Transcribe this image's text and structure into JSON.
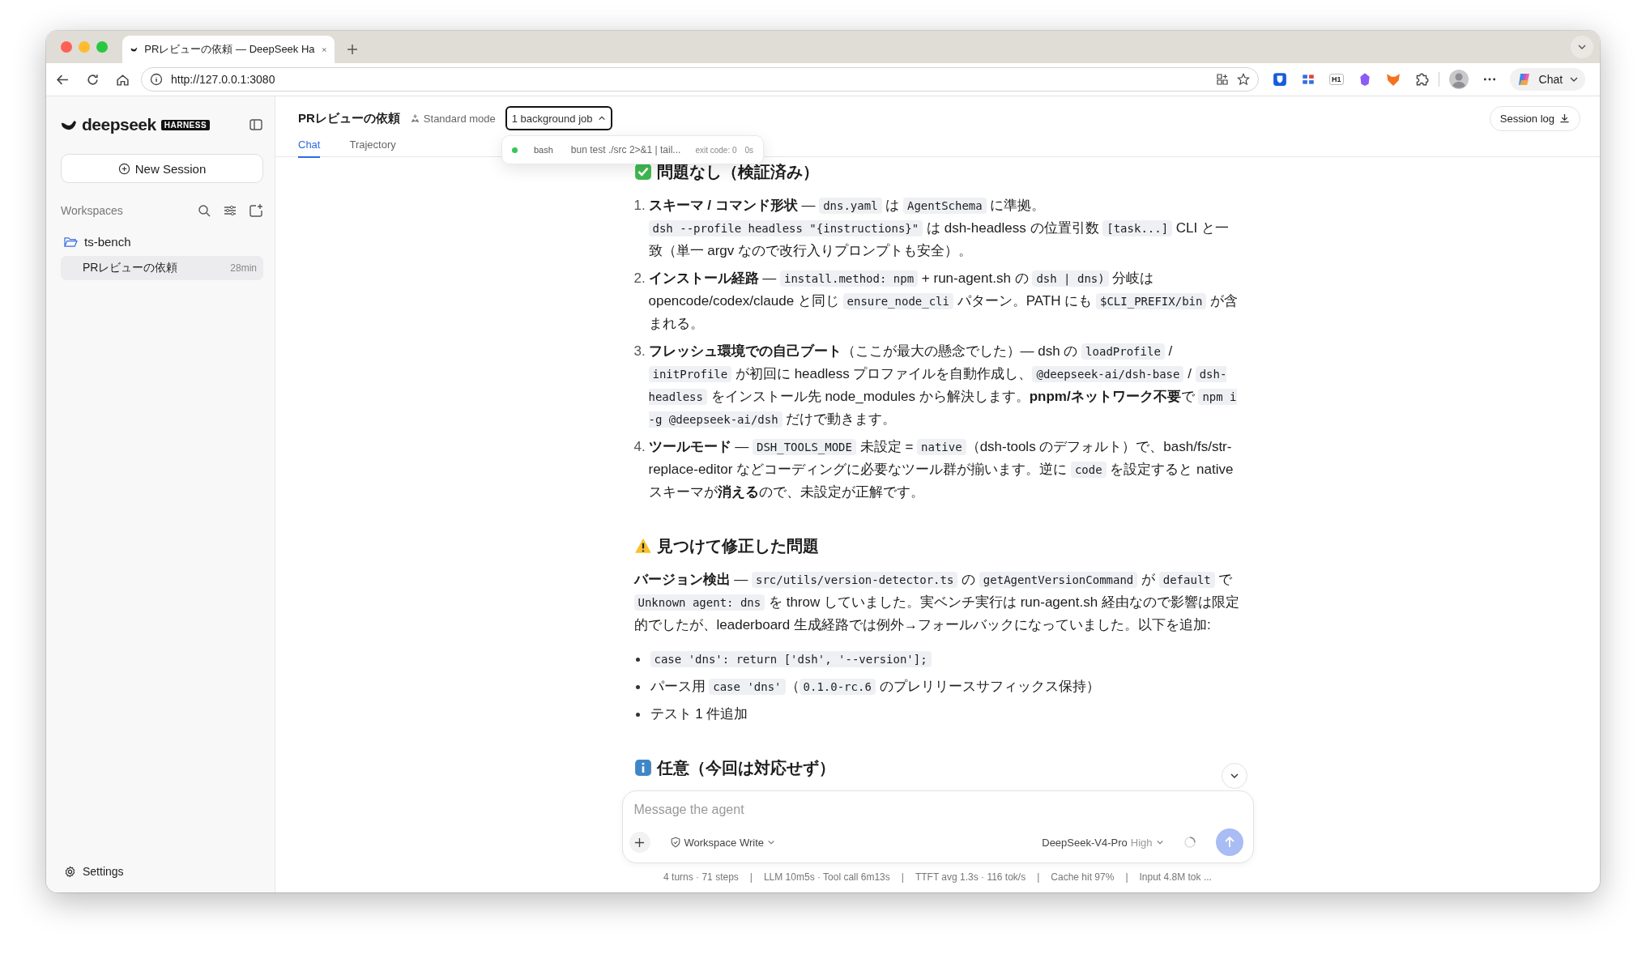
{
  "browser": {
    "tab_title": "PRレビューの依頼 — DeepSeek Ha",
    "url": "http://127.0.0.1:3080",
    "extensions": [
      {
        "kind": "shield"
      },
      {
        "kind": "grid"
      },
      {
        "kind": "badge",
        "label": "H1"
      },
      {
        "kind": "gem"
      },
      {
        "kind": "fox"
      },
      {
        "kind": "puzzle"
      }
    ],
    "copilot_label": "Chat"
  },
  "sidebar": {
    "logo": "deepseek",
    "badge": "HARNESS",
    "new_session": "New Session",
    "workspaces_label": "Workspaces",
    "tree": [
      {
        "name": "ts-bench",
        "expanded": true,
        "children": [
          {
            "title": "PRレビューの依頼",
            "time": "28min",
            "selected": true
          }
        ]
      }
    ],
    "settings": "Settings"
  },
  "header": {
    "title": "PRレビューの依頼",
    "mode": "Standard mode",
    "jobs_button": "1 background job",
    "jobs_expanded": true,
    "tabs": [
      {
        "label": "Chat",
        "selected": true
      },
      {
        "label": "Trajectory",
        "selected": false
      }
    ],
    "session_log": "Session log",
    "jobs": [
      {
        "color": "#34c759",
        "tool": "bash",
        "command": "bun test ./src 2>&1 | tail...",
        "exit": "exit code: 0",
        "duration": "0s"
      }
    ]
  },
  "content": [
    {
      "kind": "heading",
      "text": "問題なし（検証済み）"
    },
    {
      "kind": "ordered",
      "items": [
        {
          "number": "1.",
          "segments": [
            {
              "kind": "text",
              "text": "**スキーマ / コマンド形状** — "
            },
            {
              "kind": "code",
              "text": "dns.yaml"
            },
            {
              "kind": "text",
              "text": " は "
            },
            {
              "kind": "code",
              "text": "AgentSchema"
            },
            {
              "kind": "text",
              "text": " に準拠。"
            },
            {
              "kind": "break"
            },
            {
              "kind": "code",
              "text": "dsh --profile headless \"{instructions}\""
            },
            {
              "kind": "text",
              "text": " は dsh-headless の位置引数 "
            },
            {
              "kind": "code",
              "text": "[task...]"
            },
            {
              "kind": "text",
              "text": " CLI と一致（単一 argv なので改行入りプロンプトも安全）。"
            }
          ]
        },
        {
          "number": "2.",
          "segments": [
            {
              "kind": "text",
              "text": "**インストール経路** — "
            },
            {
              "kind": "code",
              "text": "install.method: npm"
            },
            {
              "kind": "text",
              "text": " + run-agent.sh の "
            },
            {
              "kind": "code",
              "text": "dsh | dns)"
            },
            {
              "kind": "text",
              "text": " 分岐は opencode/codex/claude と同じ "
            },
            {
              "kind": "code",
              "text": "ensure_node_cli"
            },
            {
              "kind": "text",
              "text": " パターン。PATH にも "
            },
            {
              "kind": "code",
              "text": "$CLI_PREFIX/bin"
            },
            {
              "kind": "text",
              "text": " が含まれる。"
            }
          ]
        },
        {
          "number": "3.",
          "segments": [
            {
              "kind": "text",
              "text": "**フレッシュ環境での自己ブート**（ここが最大の懸念でした）— dsh の "
            },
            {
              "kind": "code",
              "text": "loadProfile"
            },
            {
              "kind": "text",
              "text": " / "
            },
            {
              "kind": "code",
              "text": "initProfile"
            },
            {
              "kind": "text",
              "text": " が初回に headless プロファイルを自動作成し、"
            },
            {
              "kind": "code",
              "text": "@deepseek-ai/dsh-base"
            },
            {
              "kind": "text",
              "text": " / "
            },
            {
              "kind": "code",
              "text": "dsh-headless"
            },
            {
              "kind": "text",
              "text": " をインストール先 node_modules から解決します。**pnpm/ネットワーク不要**で "
            },
            {
              "kind": "code",
              "text": "npm i -g @deepseek-ai/dsh"
            },
            {
              "kind": "text",
              "text": " だけで動きます。"
            }
          ]
        },
        {
          "number": "4.",
          "segments": [
            {
              "kind": "text",
              "text": "**ツールモード** — "
            },
            {
              "kind": "code",
              "text": "DSH_TOOLS_MODE"
            },
            {
              "kind": "text",
              "text": " 未設定 = "
            },
            {
              "kind": "code",
              "text": "native"
            },
            {
              "kind": "text",
              "text": "（dsh-tools のデフォルト）で、bash/fs/str-replace-editor などコーディングに必要なツール群が揃います。逆に "
            },
            {
              "kind": "code",
              "text": "code"
            },
            {
              "kind": "text",
              "text": " を設定すると native スキーマが**消える**ので、未設定が正解です。"
            }
          ]
        }
      ]
    },
    {
      "kind": "heading",
      "text": "見つけて修正した問題"
    },
    {
      "kind": "paragraph",
      "segments": [
        {
          "kind": "text",
          "text": "**バージョン検出** — "
        },
        {
          "kind": "code",
          "text": "src/utils/version-detector.ts"
        },
        {
          "kind": "text",
          "text": " の "
        },
        {
          "kind": "code",
          "text": "getAgentVersionCommand"
        },
        {
          "kind": "text",
          "text": " が "
        },
        {
          "kind": "code",
          "text": "default"
        },
        {
          "kind": "text",
          "text": " で "
        },
        {
          "kind": "code",
          "text": "Unknown agent: dns"
        },
        {
          "kind": "text",
          "text": " を throw していました。実ベンチ実行は run-agent.sh 経由なので影響は限定的でしたが、leaderboard 生成経路では例外→フォールバックになっていました。以下を追加:"
        }
      ]
    },
    {
      "kind": "bullets",
      "items": [
        [
          {
            "kind": "code",
            "text": "case 'dns': return ['dsh', '--version'];"
          }
        ],
        [
          {
            "kind": "text",
            "text": "パース用 "
          },
          {
            "kind": "code",
            "text": "case 'dns'"
          },
          {
            "kind": "text",
            "text": "（"
          },
          {
            "kind": "code",
            "text": "0.1.0-rc.6"
          },
          {
            "kind": "text",
            "text": " のプレリリースサフィックス保持）"
          }
        ],
        [
          {
            "kind": "text",
            "text": "テスト 1 件追加"
          }
        ]
      ]
    },
    {
      "kind": "heading",
      "text": "任意（今回は対応せず）"
    }
  ],
  "composer": {
    "placeholder": "Message the agent",
    "permission": "Workspace Write",
    "model": "DeepSeek-V4-Pro",
    "effort": "High",
    "loading": true,
    "send_disabled": true
  },
  "status_bar": {
    "separator": "|",
    "items": [
      "4 turns · 71 steps",
      "LLM 10m5s · Tool call 6m13s",
      "TTFT avg 1.3s · 116 tok/s",
      "Cache hit 97%",
      "Input 4.8M tok ..."
    ]
  }
}
